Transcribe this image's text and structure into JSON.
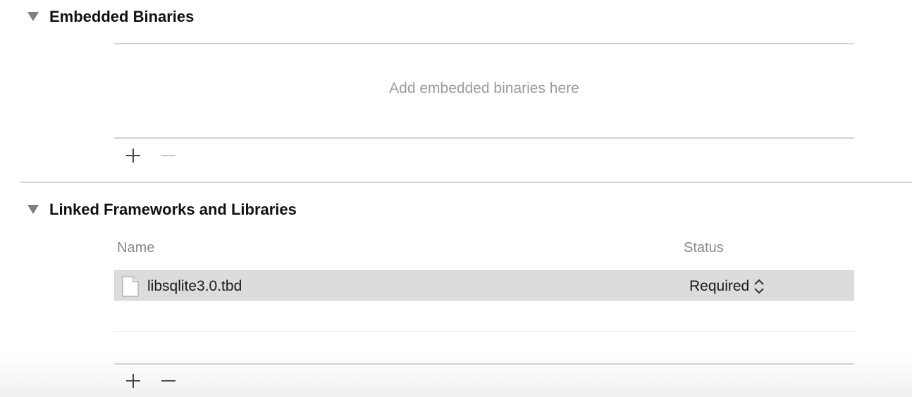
{
  "embedded_binaries": {
    "title": "Embedded Binaries",
    "empty_message": "Add embedded binaries here",
    "add_icon": "plus-icon",
    "remove_icon": "minus-icon"
  },
  "linked_frameworks": {
    "title": "Linked Frameworks and Libraries",
    "columns": {
      "name": "Name",
      "status": "Status"
    },
    "rows": [
      {
        "name": "libsqlite3.0.tbd",
        "status": "Required",
        "icon": "document-icon",
        "selected": true
      }
    ],
    "add_icon": "plus-icon",
    "remove_icon": "minus-icon"
  },
  "colors": {
    "selected_row": "#dcdcdc",
    "divider": "#d4d4d4",
    "placeholder_text": "#9b9b9b",
    "disclosure_triangle": "#7f7f7f"
  }
}
